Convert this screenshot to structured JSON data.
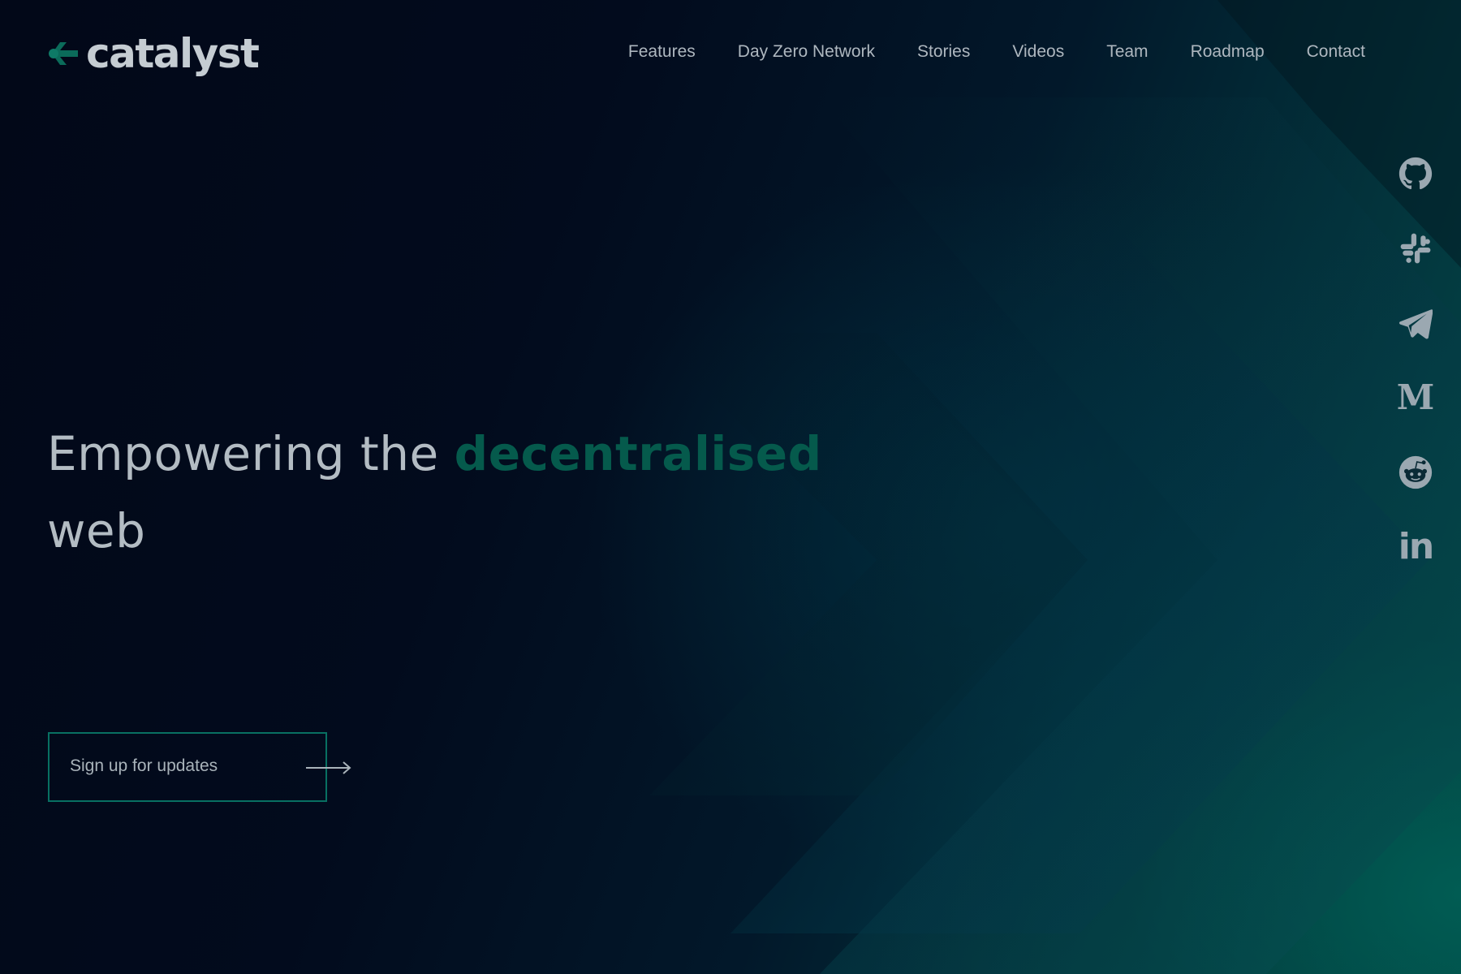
{
  "brand": {
    "name": "catalyst",
    "accent_color": "#0b6b5a",
    "text_color": "#c5ccd2"
  },
  "nav": {
    "items": [
      {
        "label": "Features"
      },
      {
        "label": "Day Zero Network"
      },
      {
        "label": "Stories"
      },
      {
        "label": "Videos"
      },
      {
        "label": "Team"
      },
      {
        "label": "Roadmap"
      },
      {
        "label": "Contact"
      }
    ]
  },
  "social": {
    "icons": [
      "github-icon",
      "slack-icon",
      "telegram-icon",
      "medium-icon",
      "reddit-icon",
      "linkedin-icon"
    ],
    "medium_glyph": "M",
    "linkedin_glyph": "in",
    "icon_color": "#9ba8b1"
  },
  "hero": {
    "title_prefix": "Empowering the ",
    "title_accent": "decentralised",
    "title_suffix": "web",
    "accent_color": "#055a4c"
  },
  "cta": {
    "label": "Sign up for updates",
    "border_color": "#087062"
  },
  "theme": {
    "background_dark": "#020a1c",
    "background_teal": "#054d4a"
  }
}
